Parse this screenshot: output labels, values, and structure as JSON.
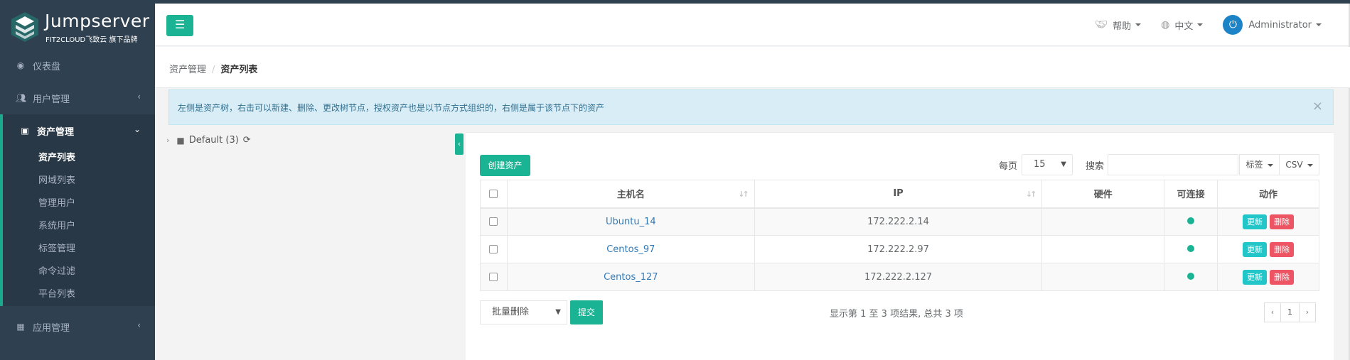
{
  "app": {
    "title": "Jumpserver",
    "subtitle": "FIT2CLOUD飞致云 旗下品牌"
  },
  "colors": {
    "sidebar_bg": "#2f4050",
    "accent": "#1ab394",
    "info_button": "#23c6c8",
    "danger_button": "#ed5565",
    "link": "#337ab7"
  },
  "sidebar": {
    "items": [
      {
        "label": "仪表盘",
        "icon": "dashboard-icon"
      },
      {
        "label": "用户管理",
        "icon": "users-icon"
      },
      {
        "label": "资产管理",
        "icon": "inbox-icon"
      },
      {
        "label": "应用管理",
        "icon": "grid-icon"
      }
    ],
    "asset_sub_items": [
      {
        "label": "资产列表"
      },
      {
        "label": "网域列表"
      },
      {
        "label": "管理用户"
      },
      {
        "label": "系统用户"
      },
      {
        "label": "标签管理"
      },
      {
        "label": "命令过滤"
      },
      {
        "label": "平台列表"
      }
    ]
  },
  "header": {
    "help_label": "帮助",
    "language_label": "中文",
    "user_label": "Administrator"
  },
  "breadcrumb": {
    "parent": "资产管理",
    "current": "资产列表"
  },
  "alert": {
    "text": "左侧是资产树，右击可以新建、删除、更改树节点，授权资产也是以节点方式组织的，右侧是属于该节点下的资产"
  },
  "tree": {
    "root_label": "Default (3)"
  },
  "toolbar": {
    "create_label": "创建资产",
    "page_size_label": "每页",
    "page_size_value": "15",
    "search_label": "搜索",
    "search_value": "",
    "tag_label": "标签",
    "csv_label": "CSV"
  },
  "table": {
    "headers": [
      "主机名",
      "IP",
      "硬件",
      "可连接",
      "动作"
    ],
    "rows": [
      {
        "hostname": "Ubuntu_14",
        "ip": "172.222.2.14",
        "hardware": "",
        "connectable": true
      },
      {
        "hostname": "Centos_97",
        "ip": "172.222.2.97",
        "hardware": "",
        "connectable": true
      },
      {
        "hostname": "Centos_127",
        "ip": "172.222.2.127",
        "hardware": "",
        "connectable": true
      }
    ],
    "update_label": "更新",
    "delete_label": "删除"
  },
  "footer": {
    "bulk_action_label": "批量删除",
    "submit_label": "提交",
    "info_text": "显示第 1 至 3 项结果, 总共 3 项",
    "prev_label": "‹",
    "current_page": "1",
    "next_label": "›"
  }
}
